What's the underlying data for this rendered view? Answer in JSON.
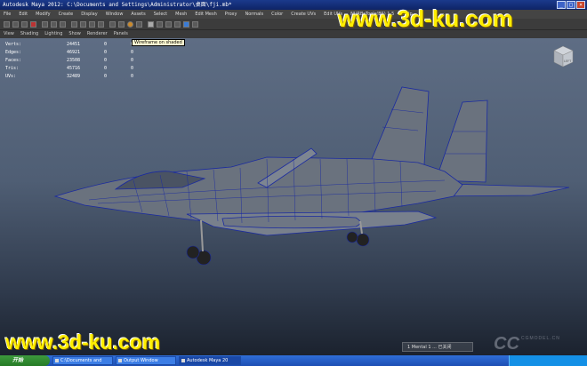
{
  "window": {
    "title": "Autodesk Maya 2012: C:\\Documents and Settings\\Administrator\\桌面\\fji.mb*",
    "buttons": [
      "_",
      "□",
      "×"
    ]
  },
  "menubar": {
    "items": [
      "File",
      "Edit",
      "Modify",
      "Create",
      "Display",
      "Window",
      "Assets",
      "Select",
      "Mesh",
      "Edit Mesh",
      "Proxy",
      "Normals",
      "Color",
      "Create UVs",
      "Edit UVs",
      "NURBsTools(BS) 1.5",
      "Help"
    ]
  },
  "tooltip": {
    "text": "Wireframe on shaded"
  },
  "viewport_menu": {
    "items": [
      "View",
      "Shading",
      "Lighting",
      "Show",
      "Renderer",
      "Panels"
    ]
  },
  "hud": {
    "rows": [
      {
        "label": "Verts:",
        "v1": "24451",
        "v2": "0",
        "v3": "0"
      },
      {
        "label": "Edges:",
        "v1": "46921",
        "v2": "0",
        "v3": "0"
      },
      {
        "label": "Faces:",
        "v1": "23508",
        "v2": "0",
        "v3": "0"
      },
      {
        "label": "Tris:",
        "v1": "45716",
        "v2": "0",
        "v3": "0"
      },
      {
        "label": "UVs:",
        "v1": "32489",
        "v2": "0",
        "v3": "0"
      }
    ]
  },
  "viewcube": {
    "face_label": "LEFT"
  },
  "watermark": {
    "top": "www.3d-ku.com",
    "bottom": "www.3d-ku.com",
    "cc": "CC",
    "cc_sub": "CGMODEL.CN"
  },
  "notice": {
    "text": "1 Mental 1 ... 已关闭"
  },
  "taskbar": {
    "start": "开始",
    "tasks": [
      "C:\\Documents and",
      "Output Window",
      "Autodesk Maya 20"
    ]
  },
  "colors": {
    "titlebar": "#1b3a8c",
    "viewport_top": "#5e6d84",
    "viewport_bottom": "#1b222e",
    "wire": "#1a2aa0",
    "watermark": "#ffee00"
  }
}
